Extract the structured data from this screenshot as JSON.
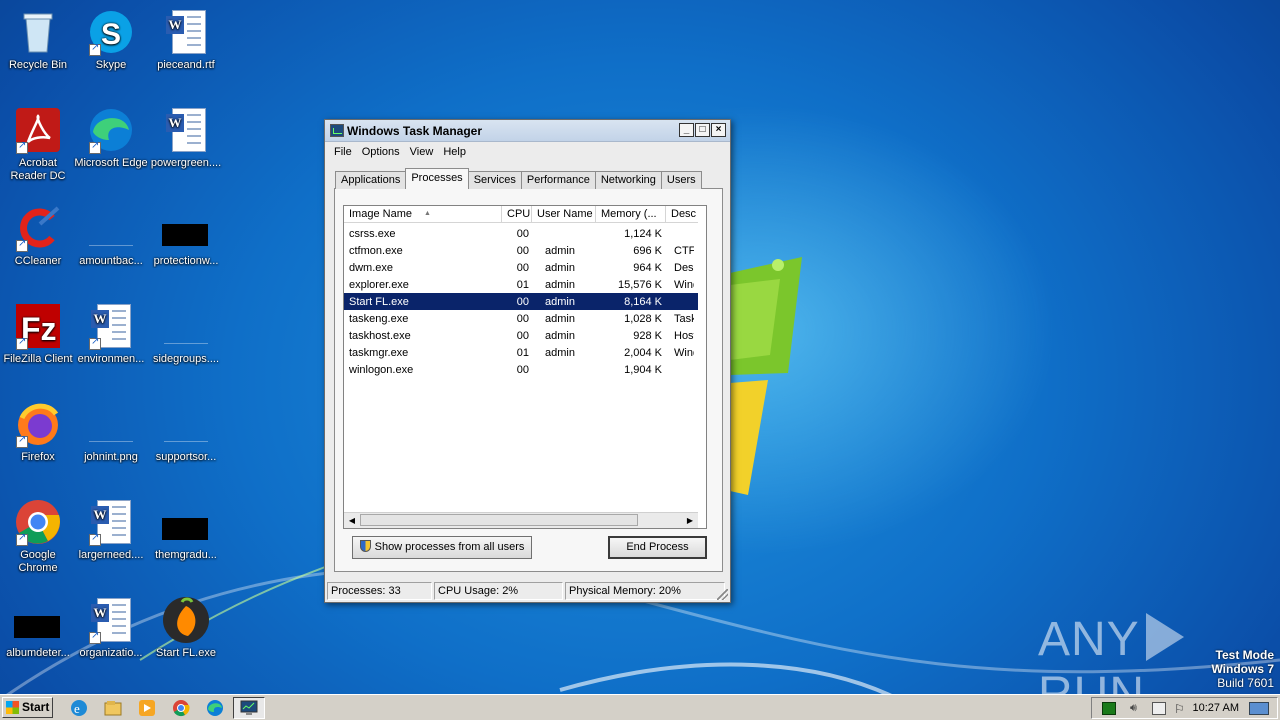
{
  "desktop": {
    "icons": [
      {
        "name": "Recycle Bin"
      },
      {
        "name": "Skype"
      },
      {
        "name": "pieceand.rtf"
      },
      {
        "name": "Acrobat Reader DC"
      },
      {
        "name": "Microsoft Edge"
      },
      {
        "name": "powergreen...."
      },
      {
        "name": "CCleaner"
      },
      {
        "name": "amountbac..."
      },
      {
        "name": "protectionw..."
      },
      {
        "name": "FileZilla Client"
      },
      {
        "name": "environmen..."
      },
      {
        "name": "sidegroups...."
      },
      {
        "name": "Firefox"
      },
      {
        "name": "johnint.png"
      },
      {
        "name": "supportsor..."
      },
      {
        "name": "Google Chrome"
      },
      {
        "name": "largerneed...."
      },
      {
        "name": "themgradu..."
      },
      {
        "name": "albumdeter..."
      },
      {
        "name": "organizatio..."
      },
      {
        "name": "Start FL.exe"
      }
    ]
  },
  "task_manager": {
    "title": "Windows Task Manager",
    "menu": [
      "File",
      "Options",
      "View",
      "Help"
    ],
    "tabs": [
      "Applications",
      "Processes",
      "Services",
      "Performance",
      "Networking",
      "Users"
    ],
    "active_tab": "Processes",
    "columns": [
      "Image Name",
      "CPU",
      "User Name",
      "Memory (...",
      "Desc"
    ],
    "rows": [
      {
        "name": "csrss.exe",
        "cpu": "00",
        "user": "",
        "mem": "1,124 K",
        "desc": ""
      },
      {
        "name": "ctfmon.exe",
        "cpu": "00",
        "user": "admin",
        "mem": "696 K",
        "desc": "CTF L"
      },
      {
        "name": "dwm.exe",
        "cpu": "00",
        "user": "admin",
        "mem": "964 K",
        "desc": "Desk"
      },
      {
        "name": "explorer.exe",
        "cpu": "01",
        "user": "admin",
        "mem": "15,576 K",
        "desc": "Wind"
      },
      {
        "name": "Start FL.exe",
        "cpu": "00",
        "user": "admin",
        "mem": "8,164 K",
        "desc": "",
        "selected": true
      },
      {
        "name": "taskeng.exe",
        "cpu": "00",
        "user": "admin",
        "mem": "1,028 K",
        "desc": "Task"
      },
      {
        "name": "taskhost.exe",
        "cpu": "00",
        "user": "admin",
        "mem": "928 K",
        "desc": "Host"
      },
      {
        "name": "taskmgr.exe",
        "cpu": "01",
        "user": "admin",
        "mem": "2,004 K",
        "desc": "Wind"
      },
      {
        "name": "winlogon.exe",
        "cpu": "00",
        "user": "",
        "mem": "1,904 K",
        "desc": ""
      }
    ],
    "show_all_label": "Show processes from all users",
    "end_process_label": "End Process",
    "status": {
      "processes": "Processes: 33",
      "cpu": "CPU Usage: 2%",
      "memory": "Physical Memory: 20%"
    }
  },
  "watermark": {
    "brand_left": "ANY",
    "brand_right": "RUN",
    "test_mode": "Test Mode",
    "os": "Windows 7",
    "build": "Build 7601"
  },
  "taskbar": {
    "start_label": "Start",
    "clock": "10:27 AM"
  },
  "colors": {
    "selection": "#0a246a",
    "desktop_blue": "#0f6fc8",
    "taskbar": "#d4d0c8"
  }
}
